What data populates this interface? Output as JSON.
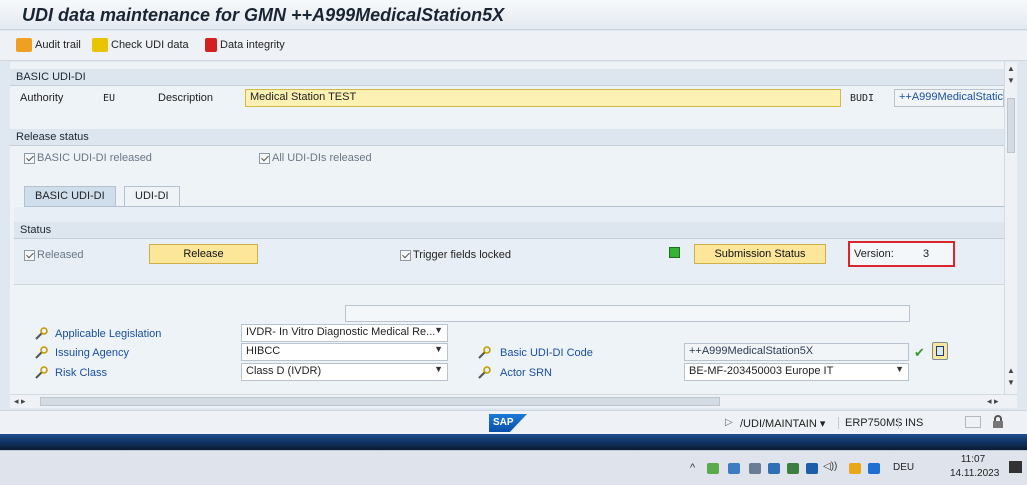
{
  "window": {
    "title": "UDI data maintenance for GMN ++A999MedicalStation5X"
  },
  "toolbar": {
    "audit_trail": "Audit trail",
    "check_udi": "Check UDI data",
    "data_integrity": "Data integrity"
  },
  "basic_udi": {
    "header": "BASIC UDI-DI",
    "authority_label": "Authority",
    "authority_value": "EU",
    "description_label": "Description",
    "description_value": "Medical Station TEST",
    "budi_label": "BUDI",
    "budi_value": "++A999MedicalStatic"
  },
  "release_status": {
    "header": "Release status",
    "basic_released": "BASIC UDI-DI released",
    "all_released": "All UDI-DIs released"
  },
  "tabs": [
    {
      "label": "BASIC UDI-DI"
    },
    {
      "label": "UDI-DI"
    }
  ],
  "status": {
    "header": "Status",
    "released": "Released",
    "release_button": "Release",
    "trigger_fields": "Trigger fields locked",
    "submission_button": "Submission Status",
    "version_label": "Version:",
    "version_value": "3"
  },
  "fields": {
    "applicable_legislation_label": "Applicable Legislation",
    "applicable_legislation_value": "IVDR- In Vitro Diagnostic Medical Re...",
    "issuing_agency_label": "Issuing Agency",
    "issuing_agency_value": "HIBCC",
    "risk_class_label": "Risk Class",
    "risk_class_value": "Class D (IVDR)",
    "basic_udi_code_label": "Basic UDI-DI Code",
    "basic_udi_code_value": "++A999MedicalStation5X",
    "actor_srn_label": "Actor SRN",
    "actor_srn_value": "BE-MF-203450003 Europe IT"
  },
  "statusbar": {
    "sap_logo": "SAP",
    "transaction": "/UDI/MAINTAIN",
    "system": "ERP750MS",
    "mode": "INS"
  },
  "taskbar": {
    "lang": "DEU",
    "time": "11:07",
    "date": "14.11.2023"
  },
  "colors": {
    "highlight_box": "#d9262c",
    "button_yellow": "#fbe69a",
    "status_green": "#33b233"
  }
}
